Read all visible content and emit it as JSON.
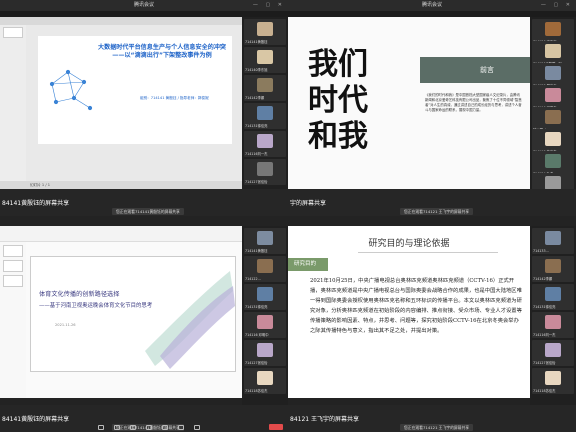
{
  "q1": {
    "window_title": "腾讯会议",
    "slide_title": "大数据时代平台信息生产与个人信息安全的冲突——以“滴滴出行”下架整改事件为例",
    "slide_meta": "组别：714141 黄殷钰 / 指导老师：郭俊妮",
    "status": "幻灯片 1 / 1",
    "shared_name": "84141黄殷钰的屏幕共享",
    "share_badge": "您正在观看714141黄殷钰的屏幕共享",
    "participants": [
      "714141黄殷钰",
      "714140李东旭",
      "714142李娜",
      "714131徐佳亮",
      "714116刘一杰",
      "714127张佳怡",
      "714128邢家柔"
    ]
  },
  "q2": {
    "window_title": "腾讯会议",
    "big_title": "我们时代和我",
    "banner": "前言",
    "foreword": "《我们的时代和我》是中国首档大型国家级人文纪录片，由腾讯新闻和北京爱奇艺科技有限公司出品，聚焦了十位不同领域“智慧者”对人生的真诚，通过讲述自己的成长经历与思考，讲述个人奋斗与国家命运的联系，展现中国力量。",
    "shared_name": "宇的屏幕共享",
    "share_badge": "您正在观看714121 王飞宇的屏幕共享",
    "participants": [
      "714126 宋清宁",
      "714150王智群（赵…",
      "714128 翟佳玉",
      "714116 邓明中",
      "韩以国（…",
      "714118 苏佳杰",
      "714124 孙浩",
      "714121 王飞宇"
    ]
  },
  "q3": {
    "slide_title_1": "体育文化传播的创新路径选择",
    "slide_title_2": "——基于河南卫视奥运晚会体育文化节目的思考",
    "slide_meta": "2021.11.26",
    "shared_name": "84141黄殷钰的屏幕共享",
    "share_badge": "您正在观看714141黄殷钰的屏幕共享",
    "participants": [
      "714141黄殷钰",
      "714122…",
      "714131徐佳亮",
      "714116 邓明中",
      "714127张佳怡",
      "714118苏佳杰"
    ]
  },
  "q4": {
    "heading": "研究目的与理论依据",
    "section": "研究目的",
    "paragraph": "2021年10月25日，中央广播电视总台奥林匹克频道奥林匹克频道（CCTV-16）正式开播，奥林匹克频道是中央广播电视总台与国际奥委会战略合作的成果，也是中国大陆地区唯一得到国际奥委会授权使用奥林匹克名称和五环标识的传播平台。本文以奥林匹克频道为研究对象，分析奥林匹克频道在初始阶段的内容编排、推点衔接、受众市场、专业人才设置等传播策略的影响因素、特点，并思考、问题等，探究初始阶段CCTV-16在北京冬奥会举办之际其传播特色与意义，指出其不足之处，并提出对策。",
    "shared_name": "84121 王飞宇的屏幕共享",
    "share_badge": "您正在观看714121 王飞宇的屏幕共享",
    "participants": [
      "714133…",
      "714142李娜",
      "714131徐佳亮",
      "714116刘一杰",
      "714127张佳怡",
      "714118苏佳杰"
    ]
  }
}
